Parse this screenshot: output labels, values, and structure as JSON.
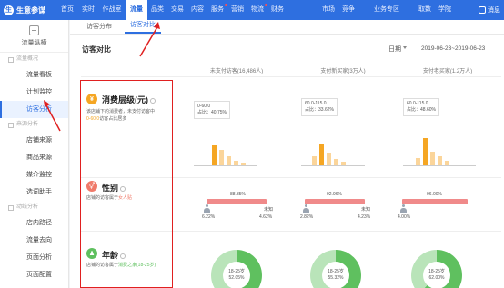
{
  "app": {
    "logo_text": "生意参谋",
    "logo_mark": "生"
  },
  "nav": {
    "items": [
      {
        "label": "首页"
      },
      {
        "label": "实时"
      },
      {
        "label": "作战室"
      },
      {
        "label": "流量"
      },
      {
        "label": "品类"
      },
      {
        "label": "交易"
      },
      {
        "label": "内容"
      },
      {
        "label": "服务"
      },
      {
        "label": "营销"
      },
      {
        "label": "物流"
      },
      {
        "label": "财务"
      },
      {
        "label": "市场"
      },
      {
        "label": "竞争"
      },
      {
        "label": "业务专区"
      },
      {
        "label": "取数"
      },
      {
        "label": "学院"
      }
    ],
    "active": "流量",
    "user_label": "消息"
  },
  "sidebar": {
    "title": "流量纵横",
    "groups": [
      {
        "label": "流量概况",
        "items": [
          "流量看板",
          "计划监控",
          "访客分析"
        ]
      },
      {
        "label": "来源分析",
        "items": [
          "店铺来源",
          "商品来源",
          "媒介监控",
          "选词助手"
        ]
      },
      {
        "label": "动线分析",
        "items": [
          "店内路径",
          "流量去向",
          "页面分析",
          "页面配置"
        ]
      }
    ],
    "active_item": "访客分析"
  },
  "tabs": [
    {
      "label": "访客分布"
    },
    {
      "label": "访客对比"
    }
  ],
  "active_tab": "访客对比",
  "panel": {
    "title": "访客对比",
    "date_label": "日期",
    "date_range": "2019-06-23~2019-06-23",
    "columns": [
      "未支付访客(16,486人)",
      "支付新买家(3万人)",
      "支付老买家(1.2万人)"
    ]
  },
  "rows": {
    "consume": {
      "title": "消费层级(元)",
      "desc_line1": "该店铺下的消费者，未支付访客中",
      "desc_hl": "0-60.0",
      "desc_line2": "访客占比居多",
      "boxes": [
        {
          "range": "0-60.0",
          "pct": "占比：40.75%"
        },
        {
          "range": "60.0-115.0",
          "pct": "占比：33.62%"
        },
        {
          "range": "60.0-115.0",
          "pct": "占比：48.60%"
        }
      ]
    },
    "gender": {
      "title": "性别",
      "desc": "店铺的访客属于",
      "desc_hl": "女人贴",
      "cols": [
        {
          "female": "88.35%",
          "unknown_label": "未知",
          "male": "6.22%",
          "unknown": "4.62%"
        },
        {
          "female": "92.96%",
          "unknown_label": "未知",
          "male": "2.82%",
          "unknown": "4.23%"
        },
        {
          "female": "96.00%",
          "unknown_label": "",
          "male": "4.00%",
          "unknown": ""
        }
      ]
    },
    "age": {
      "title": "年龄",
      "desc": "店铺的访客属于",
      "desc_hl": "消费之家(18-25岁)",
      "cols": [
        {
          "range": "18-25岁",
          "pct": "52.05%"
        },
        {
          "range": "18-25岁",
          "pct": "55.32%"
        },
        {
          "range": "18-25岁",
          "pct": "62.00%"
        }
      ]
    }
  },
  "colors": {
    "brand": "#2e6fe0",
    "consume_icon": "#f5a623",
    "gender_icon": "#f07a6a",
    "age_icon": "#5fc05f",
    "bar_orange": "#f5a623",
    "bar_light": "#fbd59a",
    "gender_bar": "#f08a8a",
    "donut": "#5fc05f",
    "annotation": "#e02020"
  }
}
